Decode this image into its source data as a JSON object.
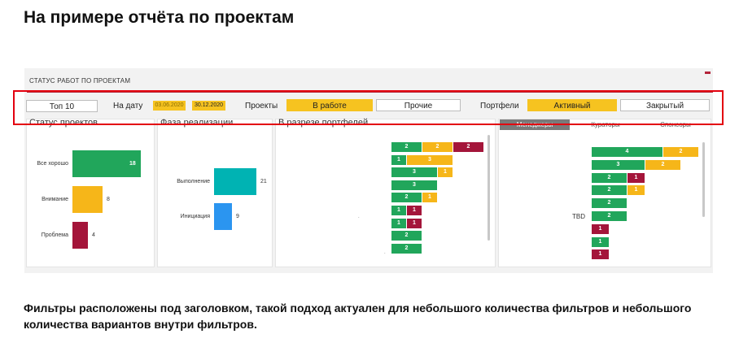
{
  "heading": "На примере отчёта по проектам",
  "report": {
    "title": "СТАТУС РАБОТ ПО ПРОЕКТАМ",
    "filters": {
      "top": "Топ 10",
      "date_label": "На дату",
      "date_from": "03.06.2020",
      "date_to": "30.12.2020",
      "projects_label": "Проекты",
      "projects_options": [
        "В работе",
        "Прочие"
      ],
      "portfolios_label": "Портфели",
      "portfolios_options": [
        "Активный",
        "Закрытый"
      ]
    },
    "panels": {
      "status": {
        "title": "Статус проектов",
        "bars": [
          {
            "label": "Все хорошо",
            "value": "18",
            "color": "#21a65b",
            "n": 18
          },
          {
            "label": "Внимание",
            "value": "8",
            "color": "#f6b619",
            "n": 8
          },
          {
            "label": "Проблема",
            "value": "4",
            "color": "#a4153a",
            "n": 4
          }
        ]
      },
      "phase": {
        "title": "Фаза реализации",
        "bars": [
          {
            "label": "Выполнение",
            "value": "21",
            "color": "#00b3b3",
            "n": 21
          },
          {
            "label": "Инициация",
            "value": "9",
            "color": "#2b95f0",
            "n": 9
          }
        ]
      },
      "portfolio": {
        "title": "В разрезе портфелей",
        "rows": [
          [
            {
              "v": "2",
              "c": "green"
            },
            {
              "v": "2",
              "c": "yellow"
            },
            {
              "v": "2",
              "c": "red"
            }
          ],
          [
            {
              "v": "1",
              "c": "green"
            },
            {
              "v": "3",
              "c": "yellow"
            }
          ],
          [
            {
              "v": "3",
              "c": "green"
            },
            {
              "v": "1",
              "c": "yellow"
            }
          ],
          [
            {
              "v": "3",
              "c": "green"
            }
          ],
          [
            {
              "v": "2",
              "c": "green"
            },
            {
              "v": "1",
              "c": "yellow"
            }
          ],
          [
            {
              "v": "1",
              "c": "green"
            },
            {
              "v": "1",
              "c": "red"
            }
          ],
          [
            {
              "v": "1",
              "c": "green"
            },
            {
              "v": "1",
              "c": "red"
            }
          ],
          [
            {
              "v": "2",
              "c": "green"
            }
          ],
          [
            {
              "v": "2",
              "c": "green"
            }
          ]
        ]
      },
      "managers": {
        "tabs": [
          "Менеджеры",
          "Кураторы",
          "Спонсоры"
        ],
        "tbd_label": "TBD",
        "rows": [
          [
            {
              "v": "4",
              "c": "green"
            },
            {
              "v": "2",
              "c": "yellow"
            }
          ],
          [
            {
              "v": "3",
              "c": "green"
            },
            {
              "v": "2",
              "c": "yellow"
            }
          ],
          [
            {
              "v": "2",
              "c": "green"
            },
            {
              "v": "1",
              "c": "red"
            }
          ],
          [
            {
              "v": "2",
              "c": "green"
            },
            {
              "v": "1",
              "c": "yellow"
            }
          ],
          [
            {
              "v": "2",
              "c": "green"
            }
          ],
          [
            {
              "v": "2",
              "c": "green"
            }
          ],
          [
            {
              "v": "1",
              "c": "red"
            }
          ],
          [
            {
              "v": "1",
              "c": "green"
            }
          ],
          [
            {
              "v": "1",
              "c": "red"
            }
          ]
        ]
      }
    }
  },
  "caption": "Фильтры расположены под заголовком, такой подход актуален для небольшого количества фильтров и небольшого количества вариантов внутри фильтров."
}
